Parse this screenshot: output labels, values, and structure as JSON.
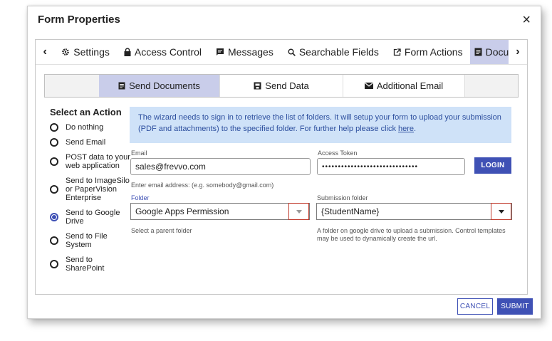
{
  "dialog": {
    "title": "Form Properties",
    "close": "×"
  },
  "tabs": [
    {
      "label": "Settings",
      "icon": "gear-icon"
    },
    {
      "label": "Access Control",
      "icon": "lock-icon"
    },
    {
      "label": "Messages",
      "icon": "message-icon"
    },
    {
      "label": "Searchable Fields",
      "icon": "search-icon"
    },
    {
      "label": "Form Actions",
      "icon": "external-link-icon"
    },
    {
      "label": "Documents",
      "icon": "document-icon"
    }
  ],
  "subtabs": [
    {
      "label": "Send Documents",
      "icon": "document-icon"
    },
    {
      "label": "Send Data",
      "icon": "data-icon"
    },
    {
      "label": "Additional Email",
      "icon": "envelope-icon"
    }
  ],
  "actions": {
    "title": "Select an Action",
    "options": [
      "Do nothing",
      "Send Email",
      "POST data to your web application",
      "Send to ImageSilo or PaperVision Enterprise",
      "Send to Google Drive",
      "Send to File System",
      "Send to SharePoint"
    ],
    "selected": "Send to Google Drive"
  },
  "info": {
    "text": "The wizard needs to sign in to retrieve the list of folders. It will setup your form to upload your submission (PDF and attachments) to the specified folder. For further help please click ",
    "link": "here",
    "end": "."
  },
  "email": {
    "label": "Email",
    "value": "sales@frevvo.com",
    "help": "Enter email address: (e.g. somebody@gmail.com)"
  },
  "token": {
    "label": "Access Token",
    "value": "••••••••••••••••••••••••••••••"
  },
  "login_label": "LOGIN",
  "folder": {
    "label": "Folder",
    "value": "Google Apps Permission",
    "help": "Select a parent folder"
  },
  "submission": {
    "label": "Submission folder",
    "value": "{StudentName}",
    "help": "A folder on google drive to upload a submission. Control templates may be used to dynamically create the url."
  },
  "footer": {
    "cancel": "CANCEL",
    "submit": "SUBMIT"
  },
  "colors": {
    "accent": "#3f51b5",
    "active_tab": "#c9cdea",
    "info_bg": "#cfe2f8"
  }
}
